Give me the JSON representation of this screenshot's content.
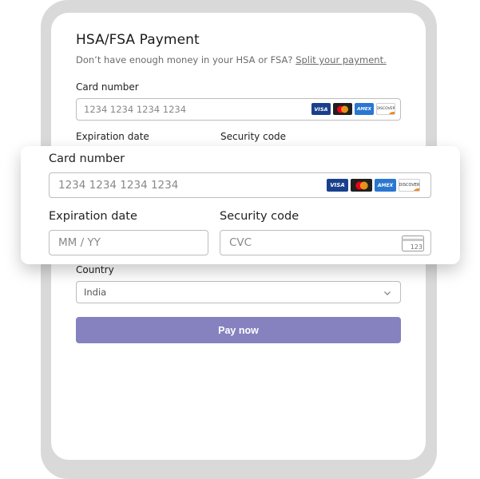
{
  "form": {
    "title": "HSA/FSA Payment",
    "subtitle_text": "Don’t have enough money in your HSA or FSA?",
    "subtitle_link": "Split your payment.",
    "card_number_label": "Card number",
    "card_number_placeholder": "1234 1234 1234 1234",
    "expiration_label": "Expiration date",
    "security_label": "Security code",
    "country_label": "Country",
    "country_value": "India",
    "pay_button": "Pay now"
  },
  "overlay": {
    "card_number_label": "Card number",
    "card_number_placeholder": "1234 1234 1234 1234",
    "expiration_label": "Expiration date",
    "expiration_placeholder": "MM / YY",
    "security_label": "Security code",
    "security_placeholder": "CVC"
  },
  "card_brands": {
    "visa": "VISA",
    "amex": "AMEX",
    "discover": "DISCOVER"
  },
  "cvc_icon_text": "123",
  "colors": {
    "pay_button": "#8582bf",
    "device_frame": "#d9d9d9",
    "visa": "#1a3f8c",
    "amex": "#2a77d0"
  }
}
